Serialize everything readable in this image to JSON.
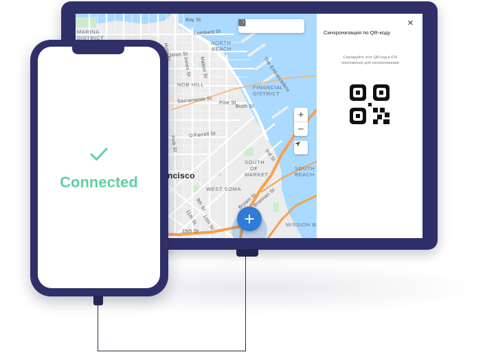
{
  "phone": {
    "status_text": "Connected"
  },
  "map": {
    "labels": [
      {
        "text": "Bay St"
      },
      {
        "text": "MARINA"
      },
      {
        "text": "DISTRICT"
      },
      {
        "text": "Lombard St"
      },
      {
        "text": "NORTH"
      },
      {
        "text": "BEACH"
      },
      {
        "text": "Hyde St"
      },
      {
        "text": "Union St"
      },
      {
        "text": "Jones St"
      },
      {
        "text": "Mason St"
      },
      {
        "text": "The Embarcadero"
      },
      {
        "text": "NOB HILL"
      },
      {
        "text": "FINANCIAL"
      },
      {
        "text": "DISTRICT"
      },
      {
        "text": "Sacramento St"
      },
      {
        "text": "Pine St"
      },
      {
        "text": "Bush St"
      },
      {
        "text": "O'Farrell St"
      },
      {
        "text": "Polk St"
      },
      {
        "text": "SOUTH"
      },
      {
        "text": "OF"
      },
      {
        "text": "MARKET"
      },
      {
        "text": "3rd St"
      },
      {
        "text": "SOUTH"
      },
      {
        "text": "BEACH"
      },
      {
        "text": "rancisco"
      },
      {
        "text": "WEST SOMA"
      },
      {
        "text": "9th St"
      },
      {
        "text": "Bryant St"
      },
      {
        "text": "Brannan St"
      },
      {
        "text": "11th St"
      },
      {
        "text": "10th St"
      },
      {
        "text": "15th St"
      },
      {
        "text": "MISSION BA"
      }
    ],
    "colors": {
      "water": "#aadaff",
      "park": "#cdeccf",
      "highway": "#f6a04d",
      "accent": "#2f7bd6"
    }
  },
  "toolbar": {
    "icons": [
      "qr-code-icon",
      "sort-icon",
      "history-icon",
      "heart-icon",
      "settings-icon"
    ]
  },
  "panel": {
    "title": "Синхронизация по QR-коду",
    "close": "×",
    "description": "Сканируйте этот QR-код в IOS приложении для синхронизации"
  },
  "fab": {
    "label": "+"
  },
  "zoom": {
    "in": "+",
    "out": "−"
  }
}
